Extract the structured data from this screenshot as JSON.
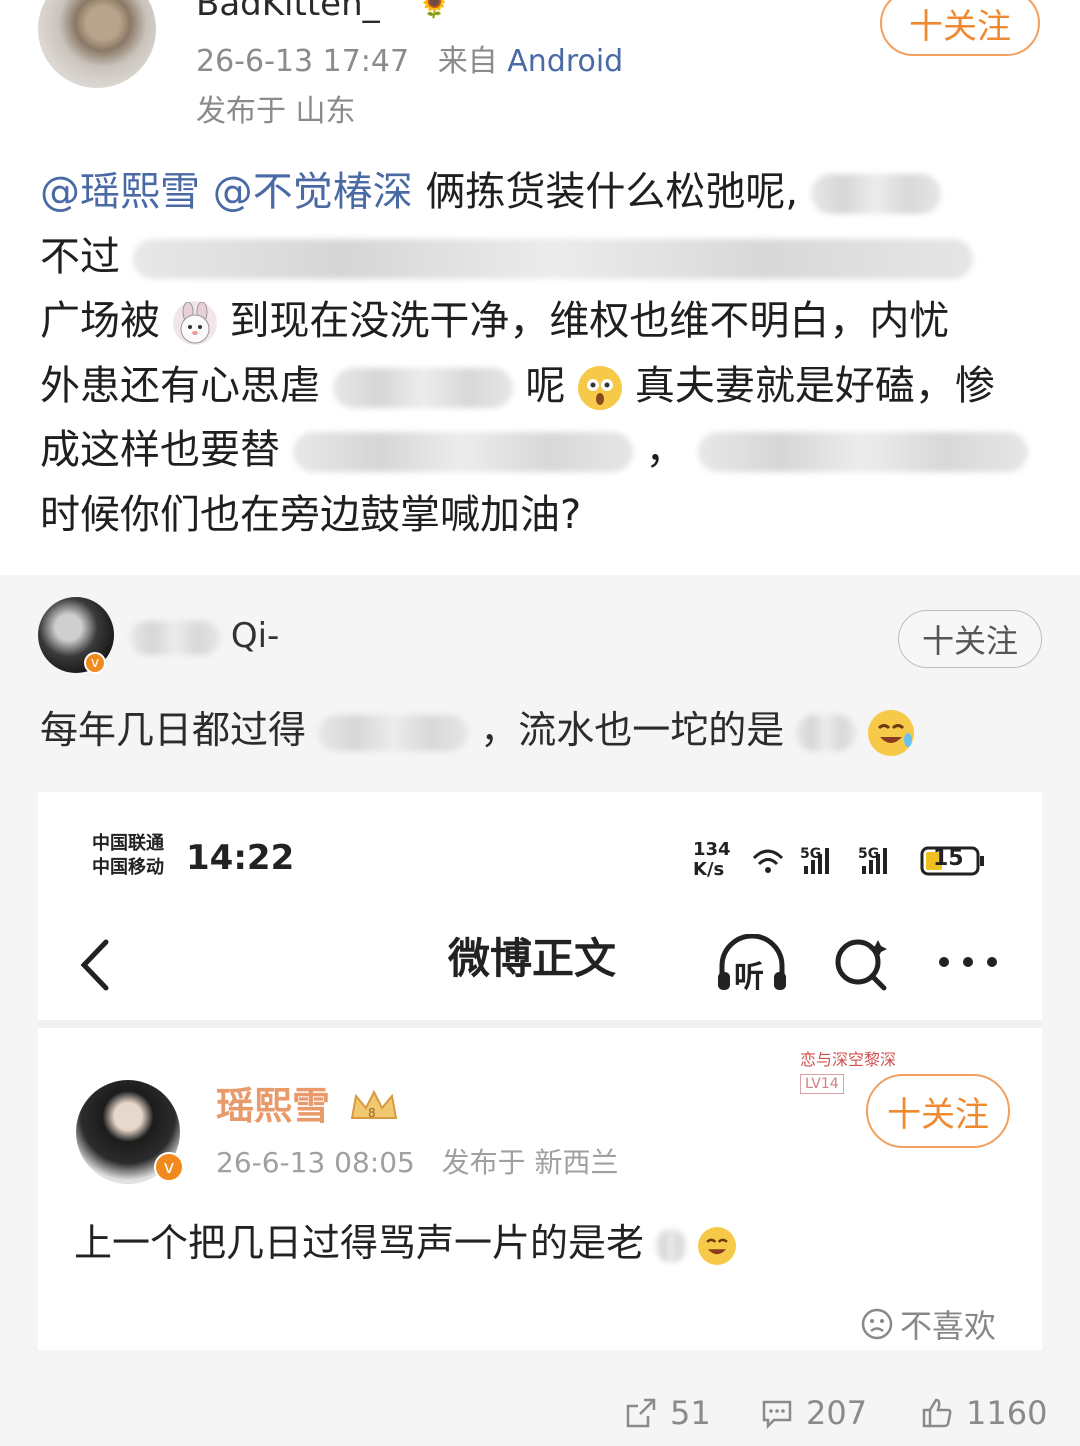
{
  "post": {
    "username": "BadKitten_",
    "time": "26-6-13 17:47",
    "source_prefix": "来自",
    "source": "Android",
    "location": "发布于 山东",
    "follow_label": "十关注",
    "mention1": "@瑶熙雪",
    "mention2": "@不觉椿深",
    "text_1": "俩拣货装什么松弛呢,",
    "text_2a": "不过",
    "text_3a": "广场被",
    "text_3b": "到现在没洗干净，维权也维不明白，内忧",
    "text_4a": "外患还有心思虐",
    "text_4b": "呢",
    "text_4c": "真夫妻就是好磕，惨",
    "text_5a": "成这样也要替",
    "text_5b": "，",
    "text_6": "时候你们也在旁边鼓掌喊加油?"
  },
  "repost": {
    "username_visible": "Qi-",
    "follow_label": "十关注",
    "text_a": "每年几日都过得",
    "text_b": "，流水也一坨的是",
    "screenshot": {
      "carrier1": "中国联通",
      "carrier2": "中国移动",
      "time": "14:22",
      "net_speed": "134\nK/s",
      "battery": "15",
      "nav_title": "微博正文",
      "listen_label": "听",
      "tag_text": "恋与深空黎深",
      "tag_level": "LV14",
      "inner_username": "瑶熙雪",
      "inner_time": "26-6-13 08:05",
      "inner_location": "发布于 新西兰",
      "inner_follow": "十关注",
      "inner_text": "上一个把几日过得骂声一片的是老",
      "dislike_label": "不喜欢"
    }
  },
  "actions": {
    "reposts": "51",
    "comments": "207",
    "likes": "1160"
  },
  "colors": {
    "mention": "#4a6aa5",
    "follow_orange": "#f08a30",
    "repost_bg": "#f5f5f5",
    "meta_gray": "#8b8b8b"
  }
}
